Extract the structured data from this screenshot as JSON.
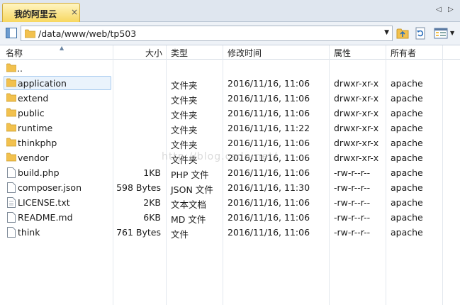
{
  "tab": {
    "label": "我的阿里云",
    "close": "×",
    "prev": "◁",
    "next": "▷"
  },
  "path": {
    "value": "/data/www/web/tp503"
  },
  "columns": {
    "name": "名称",
    "size": "大小",
    "type": "类型",
    "mtime": "修改时间",
    "attr": "属性",
    "owner": "所有者"
  },
  "rows": [
    {
      "name": "..",
      "size": "",
      "type": "",
      "mtime": "",
      "attr": "",
      "owner": "",
      "kind": "folder"
    },
    {
      "name": "application",
      "size": "",
      "type": "文件夹",
      "mtime": "2016/11/16, 11:06",
      "attr": "drwxr-xr-x",
      "owner": "apache",
      "kind": "folder"
    },
    {
      "name": "extend",
      "size": "",
      "type": "文件夹",
      "mtime": "2016/11/16, 11:06",
      "attr": "drwxr-xr-x",
      "owner": "apache",
      "kind": "folder"
    },
    {
      "name": "public",
      "size": "",
      "type": "文件夹",
      "mtime": "2016/11/16, 11:06",
      "attr": "drwxr-xr-x",
      "owner": "apache",
      "kind": "folder"
    },
    {
      "name": "runtime",
      "size": "",
      "type": "文件夹",
      "mtime": "2016/11/16, 11:22",
      "attr": "drwxr-xr-x",
      "owner": "apache",
      "kind": "folder"
    },
    {
      "name": "thinkphp",
      "size": "",
      "type": "文件夹",
      "mtime": "2016/11/16, 11:06",
      "attr": "drwxr-xr-x",
      "owner": "apache",
      "kind": "folder"
    },
    {
      "name": "vendor",
      "size": "",
      "type": "文件夹",
      "mtime": "2016/11/16, 11:06",
      "attr": "drwxr-xr-x",
      "owner": "apache",
      "kind": "folder"
    },
    {
      "name": "build.php",
      "size": "1KB",
      "type": "PHP 文件",
      "mtime": "2016/11/16, 11:06",
      "attr": "-rw-r--r--",
      "owner": "apache",
      "kind": "file"
    },
    {
      "name": "composer.json",
      "size": "598 Bytes",
      "type": "JSON 文件",
      "mtime": "2016/11/16, 11:30",
      "attr": "-rw-r--r--",
      "owner": "apache",
      "kind": "file"
    },
    {
      "name": "LICENSE.txt",
      "size": "2KB",
      "type": "文本文档",
      "mtime": "2016/11/16, 11:06",
      "attr": "-rw-r--r--",
      "owner": "apache",
      "kind": "file"
    },
    {
      "name": "README.md",
      "size": "6KB",
      "type": "MD 文件",
      "mtime": "2016/11/16, 11:06",
      "attr": "-rw-r--r--",
      "owner": "apache",
      "kind": "file"
    },
    {
      "name": "think",
      "size": "761 Bytes",
      "type": "文件",
      "mtime": "2016/11/16, 11:06",
      "attr": "-rw-r--r--",
      "owner": "apache",
      "kind": "file"
    }
  ],
  "selected_row": 1,
  "watermark": "http://blog.csdn.net/",
  "colors": {
    "tab_bg": "#f7d760",
    "folder": "#f2c14e",
    "selection": "#eaf3fc"
  },
  "icons": {
    "panel": "panel-toggle-icon",
    "folder": "folder-icon",
    "file": "file-icon",
    "up": "folder-up-icon",
    "refresh": "refresh-icon",
    "view": "view-mode-icon"
  }
}
